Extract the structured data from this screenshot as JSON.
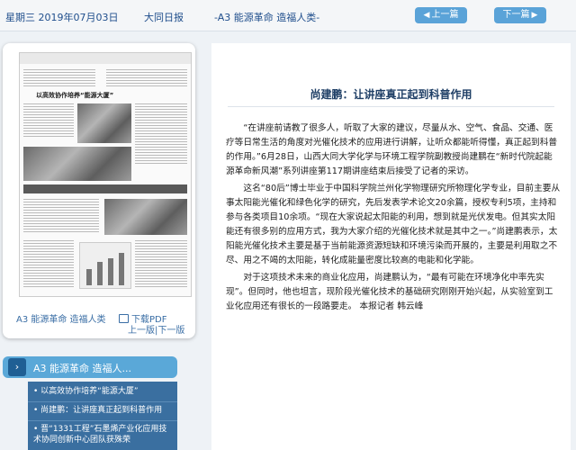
{
  "header": {
    "date": "星期三 2019年07月03日",
    "paper_name": "大同日报",
    "page_label": "-A3 能源革命 造福人类-",
    "prev_label": "上一篇",
    "next_label": "下一篇",
    "prev_icon": "chevron-left",
    "next_icon": "chevron-right"
  },
  "paper_card": {
    "page_caption": "A3 能源革命 造福人类",
    "pdf_label": "下载PDF",
    "prev_page": "上一版",
    "next_page": "下一版",
    "thumb_headline": "以高效协作培养“能源大厦”"
  },
  "article": {
    "title": "尚建鹏：让讲座真正起到科普作用",
    "paragraphs": [
      "“在讲座前请教了很多人，听取了大家的建议，尽量从水、空气、食品、交通、医疗等日常生活的角度对光催化技术的应用进行讲解，让听众都能听得懂，真正起到科普的作用。”6月28日，山西大同大学化学与环境工程学院副教授尚建鹏在“新时代院起能源革命新风潮”系列讲座第117期讲座结束后接受了记者的采访。",
      "这名“80后”博士毕业于中国科学院兰州化学物理研究所物理化学专业，目前主要从事太阳能光催化和绿色化学的研究，先后发表学术论文20余篇，授权专利5项，主持和参与各类项目10余项。“现在大家说起太阳能的利用，想到就是光伏发电。但其实太阳能还有很多别的应用方式，我为大家介绍的光催化技术就是其中之一。”尚建鹏表示，太阳能光催化技术主要是基于当前能源资源短缺和环境污染而开展的，主要是利用取之不尽、用之不竭的太阳能，转化成能量密度比较高的电能和化学能。",
      "对于这项技术未来的商业化应用，尚建鹏认为，“最有可能在环境净化中率先实现”。但同时，他也坦言，现阶段光催化技术的基础研究刚刚开始兴起，从实验室到工业化应用还有很长的一段路要走。  本报记者 韩云峰"
    ]
  },
  "sidebar": {
    "section_title": "A3  能源革命 造福人...",
    "items": [
      "以高效协作培养“能源大厦”",
      "尚建鹏：让讲座真正起到科普作用",
      "晋“1331工程”石墨烯产业化应用技术协同创新中心团队获殊荣"
    ]
  },
  "colors": {
    "accent": "#5aa3d8",
    "nav_dark": "#3a6fa0",
    "title_blue": "#1f3f66"
  }
}
